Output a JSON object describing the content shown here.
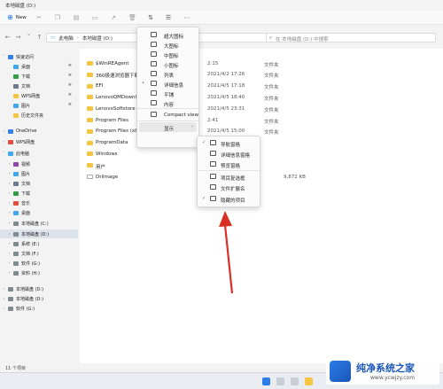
{
  "window": {
    "title": "本地磁盘 (D:)"
  },
  "toolbar": {
    "new_label": "New"
  },
  "address": {
    "crumbs": [
      "此电脑",
      "本地磁盘 (D:)"
    ],
    "search_placeholder": "在 本地磁盘 (D:) 中搜索"
  },
  "sidebar": {
    "items": [
      {
        "label": "快速访问",
        "color": "#2f80ed",
        "chevron": "˅"
      },
      {
        "label": "桌面",
        "color": "#3da9f5",
        "pinned": true
      },
      {
        "label": "下载",
        "color": "#2f9e44",
        "pinned": true
      },
      {
        "label": "文档",
        "color": "#6c7a89",
        "pinned": true
      },
      {
        "label": "WPS网盘",
        "color": "#f5c542",
        "pinned": true
      },
      {
        "label": "图片",
        "color": "#3da9f5",
        "pinned": true
      },
      {
        "label": "历史文件夹",
        "color": "#f5c542",
        "pinned": false
      },
      {
        "label": "OneDrive",
        "color": "#2f80ed",
        "chevron": "›"
      },
      {
        "label": "WPS网盘",
        "color": "#e74c3c",
        "chevron": "›"
      },
      {
        "label": "此电脑",
        "color": "#3da9f5",
        "chevron": "˅"
      },
      {
        "label": "视频",
        "color": "#8e44ad",
        "chevron": "›"
      },
      {
        "label": "图片",
        "color": "#3da9f5",
        "chevron": "›"
      },
      {
        "label": "文档",
        "color": "#6c7a89",
        "chevron": "›"
      },
      {
        "label": "下载",
        "color": "#2f9e44",
        "chevron": "›"
      },
      {
        "label": "音乐",
        "color": "#e74c3c",
        "chevron": "›"
      },
      {
        "label": "桌面",
        "color": "#3da9f5",
        "chevron": "›"
      },
      {
        "label": "本地磁盘 (C:)",
        "color": "#7f8c8d",
        "chevron": "›"
      },
      {
        "label": "本地磁盘 (D:)",
        "color": "#7f8c8d",
        "chevron": "›",
        "selected": true
      },
      {
        "label": "系统 (E:)",
        "color": "#7f8c8d",
        "chevron": "›"
      },
      {
        "label": "文档 (F:)",
        "color": "#7f8c8d",
        "chevron": "›"
      },
      {
        "label": "软件 (G:)",
        "color": "#7f8c8d",
        "chevron": "›"
      },
      {
        "label": "资料 (H:)",
        "color": "#7f8c8d",
        "chevron": "›"
      },
      {
        "label": "本地磁盘 (D:)",
        "color": "#7f8c8d",
        "chevron": "›"
      },
      {
        "label": "本地磁盘 (D:)",
        "color": "#7f8c8d",
        "chevron": "›"
      },
      {
        "label": "软件 (G:)",
        "color": "#7f8c8d",
        "chevron": "›"
      }
    ]
  },
  "files": [
    {
      "name": "$WinREAgent",
      "date": "2:15",
      "type": "文件夹",
      "size": ""
    },
    {
      "name": "360极速浏览器下载",
      "date": "2021/4/2 17:26",
      "type": "文件夹",
      "size": ""
    },
    {
      "name": "EFI",
      "date": "2021/4/5 17:18",
      "type": "文件夹",
      "size": ""
    },
    {
      "name": "LenovoQMDownload",
      "date": "2021/4/5 18:40",
      "type": "文件夹",
      "size": ""
    },
    {
      "name": "LenovoSoftstore",
      "date": "2021/4/5 23:31",
      "type": "文件夹",
      "size": ""
    },
    {
      "name": "Program Files",
      "date": "2:41",
      "type": "文件夹",
      "size": ""
    },
    {
      "name": "Program Files (x86)",
      "date": "2021/4/5 15:00",
      "type": "文件夹",
      "size": ""
    },
    {
      "name": "ProgramData",
      "date": "",
      "type": "",
      "size": ""
    },
    {
      "name": "Windows",
      "date": "2021/4/",
      "type": "",
      "size": ""
    },
    {
      "name": "用户",
      "date": "2021/4/",
      "type": "",
      "size": ""
    },
    {
      "name": "Drilmage",
      "date": "2021/6/",
      "type": "",
      "size": "9,872 KB"
    }
  ],
  "view_menu": [
    {
      "label": "超大图标"
    },
    {
      "label": "大图标"
    },
    {
      "label": "中图标"
    },
    {
      "label": "小图标"
    },
    {
      "label": "列表"
    },
    {
      "label": "详细信息",
      "checked": true
    },
    {
      "label": "平铺"
    },
    {
      "label": "内容"
    },
    {
      "label": "Compact view"
    },
    {
      "label": "显示"
    }
  ],
  "show_menu": [
    {
      "label": "导航窗格",
      "checked": true
    },
    {
      "label": "详细信息窗格"
    },
    {
      "label": "预览窗格"
    },
    {
      "label": "项目复选框"
    },
    {
      "label": "文件扩展名"
    },
    {
      "label": "隐藏的项目",
      "checked": true
    }
  ],
  "status": {
    "text": "11 个项目"
  },
  "watermark": {
    "main": "纯净系统之家",
    "sub": "www.ycwjzy.com"
  },
  "colors": {
    "folder": "#f5c542",
    "accent": "#1a73e8",
    "arrow": "#d93025"
  }
}
